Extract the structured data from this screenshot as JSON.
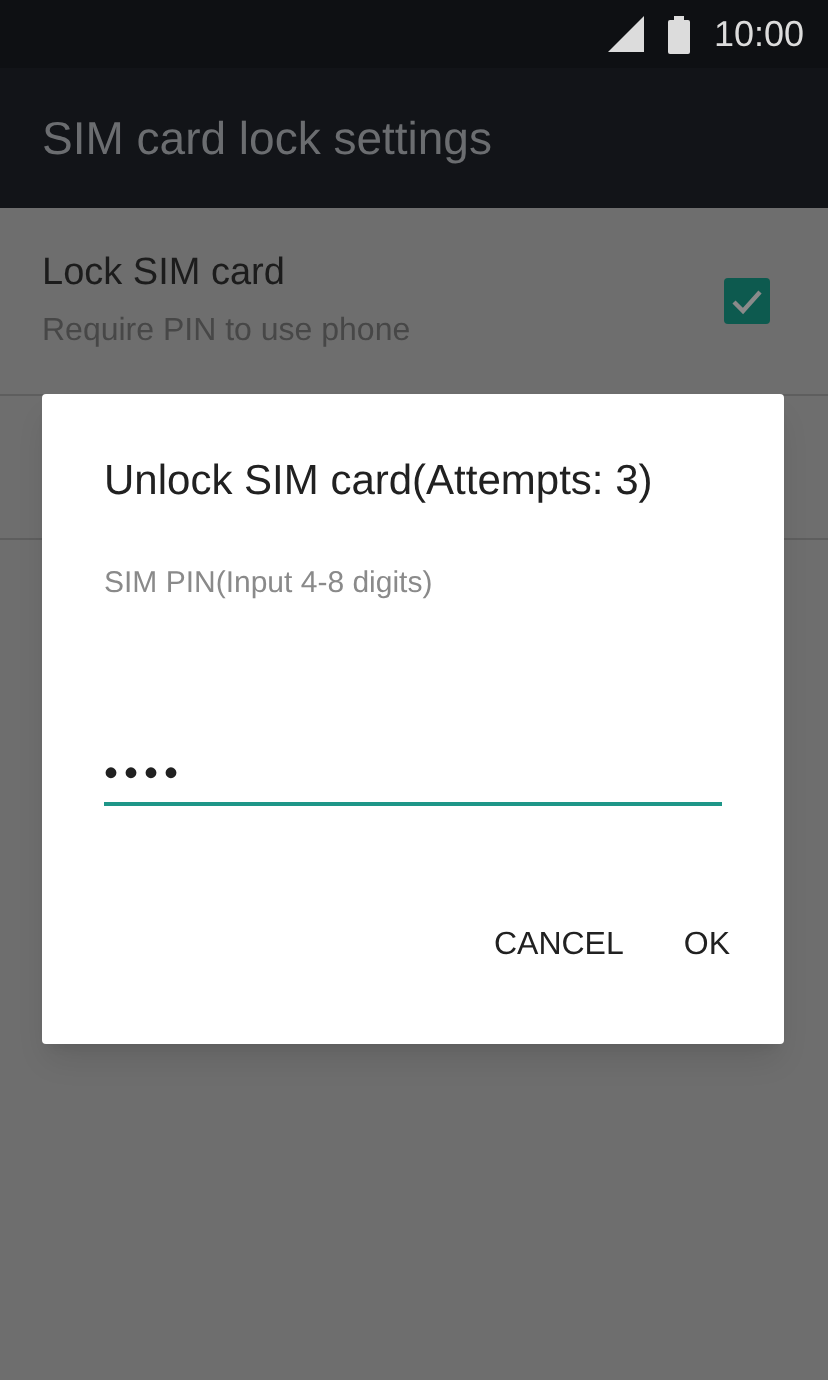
{
  "status_bar": {
    "time": "10:00"
  },
  "app_bar": {
    "title": "SIM card lock settings"
  },
  "settings": [
    {
      "title": "Lock SIM card",
      "summary": "Require PIN to use phone",
      "checked": true
    }
  ],
  "dialog": {
    "title": "Unlock SIM card(Attempts: 3)",
    "message": "SIM PIN(Input 4-8 digits)",
    "pin_field": {
      "value": "••••"
    },
    "buttons": [
      "CANCEL",
      "OK"
    ]
  }
}
